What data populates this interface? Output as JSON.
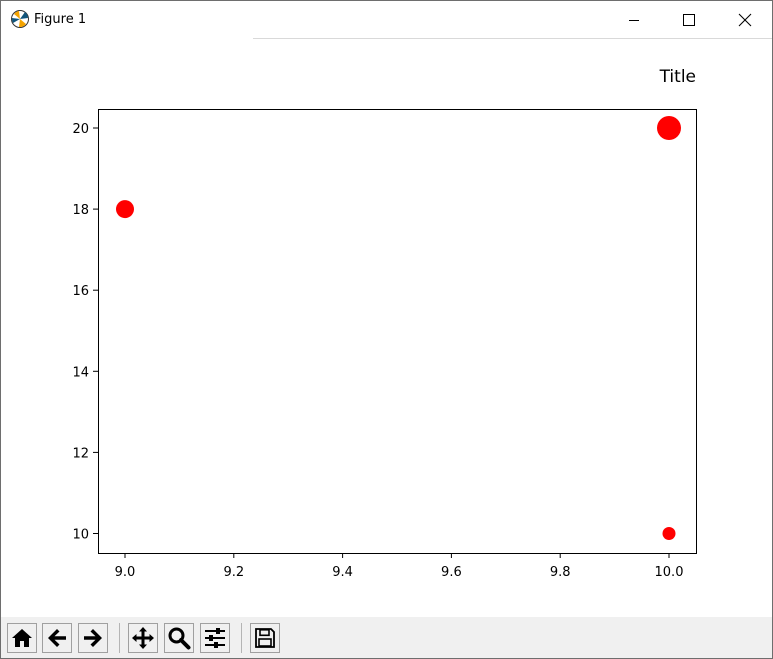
{
  "window": {
    "title": "Figure 1"
  },
  "chart_data": {
    "type": "scatter",
    "title": "Title",
    "xlabel": "",
    "ylabel": "",
    "xlim": [
      9.0,
      10.0
    ],
    "ylim": [
      9.5,
      20.5
    ],
    "xticks": [
      "9.0",
      "9.2",
      "9.4",
      "9.6",
      "9.8",
      "10.0"
    ],
    "yticks": [
      "10",
      "12",
      "14",
      "16",
      "18",
      "20"
    ],
    "x_tick_values": [
      9.0,
      9.2,
      9.4,
      9.6,
      9.8,
      10.0
    ],
    "y_tick_values": [
      10,
      12,
      14,
      16,
      18,
      20
    ],
    "grid": false,
    "legend": null,
    "color": "#ff0000",
    "series": [
      {
        "x": [
          9.0,
          10.0,
          10.0
        ],
        "y": [
          18,
          20,
          10
        ],
        "sizes": [
          2,
          3,
          1
        ]
      }
    ]
  },
  "toolbar": {
    "status": ""
  },
  "icons": [
    "app-icon",
    "minimize-icon",
    "maximize-icon",
    "close-icon",
    "home-icon",
    "back-arrow-icon",
    "forward-arrow-icon",
    "pan-icon",
    "zoom-icon",
    "configure-icon",
    "save-icon"
  ]
}
